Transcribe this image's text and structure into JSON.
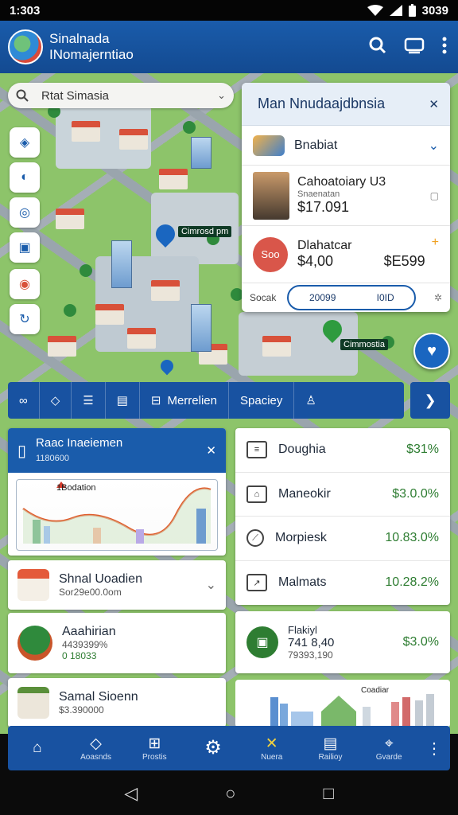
{
  "status_bar": {
    "time": "1:303",
    "battery": "3039"
  },
  "app": {
    "title_line1": "Sinalnada",
    "title_line2": "INomajerntiao"
  },
  "search": {
    "placeholder": "Rtat Simasia"
  },
  "map_labels": {
    "pin_1": "Cimrosd pm",
    "pin_2": "Cimmostia"
  },
  "panel": {
    "title": "Man Nnudaajdbnsia",
    "row1_title": "Bnabiat",
    "row2_title": "Cahoatoiary U3",
    "row2_sub": "Snaenatan",
    "row2_value": "$17.091",
    "row3_badge": "Soo",
    "row3_title": "Dlahatcar",
    "row3_value1": "$4,00",
    "row3_value2": "$E599",
    "footer_label": "Socak",
    "pill_item1": "20099",
    "pill_item2": "I0ID"
  },
  "toolbar": {
    "tab_merrelien": "Merrelien",
    "tab_spaciey": "Spaciey"
  },
  "report": {
    "title": "Raac Inaeiemen",
    "subtitle": "1180600",
    "chart_label": "1Bodation"
  },
  "list_cards": [
    {
      "title": "Shnal Uoadien",
      "sub": "Sor29e00.0om"
    },
    {
      "title": "Aaahirian",
      "sub": "4439399%",
      "green": "0 18033"
    },
    {
      "title": "Samal Sioenn",
      "sub": "$3.390000"
    }
  ],
  "stats": [
    {
      "label": "Doughia",
      "value": "$31%"
    },
    {
      "label": "Maneokir",
      "value": "$3.0.0%"
    },
    {
      "label": "Morpiesk",
      "value": "10.83.0%"
    },
    {
      "label": "Malmats",
      "value": "10.28.2%"
    }
  ],
  "price_card": {
    "title": "Flakiyl",
    "big": "741 8,40",
    "sub": "79393,190",
    "value": "$3.0%"
  },
  "mini_chart": {
    "label": "Coadiar"
  },
  "bottom_nav": [
    {
      "label": ""
    },
    {
      "label": "Aoasnds"
    },
    {
      "label": "Prostis"
    },
    {
      "label": ""
    },
    {
      "label": "Nuera"
    },
    {
      "label": "Railioy"
    },
    {
      "label": "Gvarde"
    }
  ],
  "colors": {
    "primary": "#1852a1",
    "accent_green": "#2e7d32",
    "map_green": "#8dc46a"
  }
}
